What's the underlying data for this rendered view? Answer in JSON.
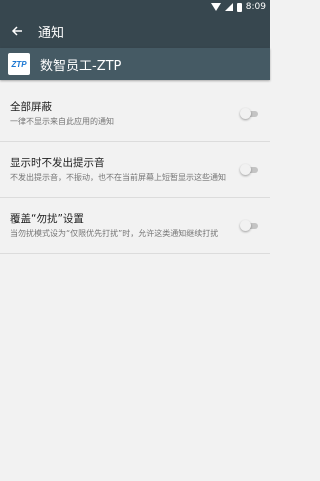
{
  "status_bar": {
    "time": "8:09"
  },
  "toolbar": {
    "title": "通知"
  },
  "app": {
    "logo_text": "ZTP",
    "name": "数智员工-ZTP"
  },
  "settings": [
    {
      "title": "全部屏蔽",
      "subtitle": "一律不显示来自此应用的通知",
      "enabled": false
    },
    {
      "title": "显示时不发出提示音",
      "subtitle": "不发出提示音，不振动，也不在当前屏幕上短暂显示这些通知",
      "enabled": false
    },
    {
      "title": "覆盖“勿扰”设置",
      "subtitle": "当勿扰模式设为“仅限优先打扰”时，允许这类通知继续打扰",
      "enabled": false
    }
  ]
}
